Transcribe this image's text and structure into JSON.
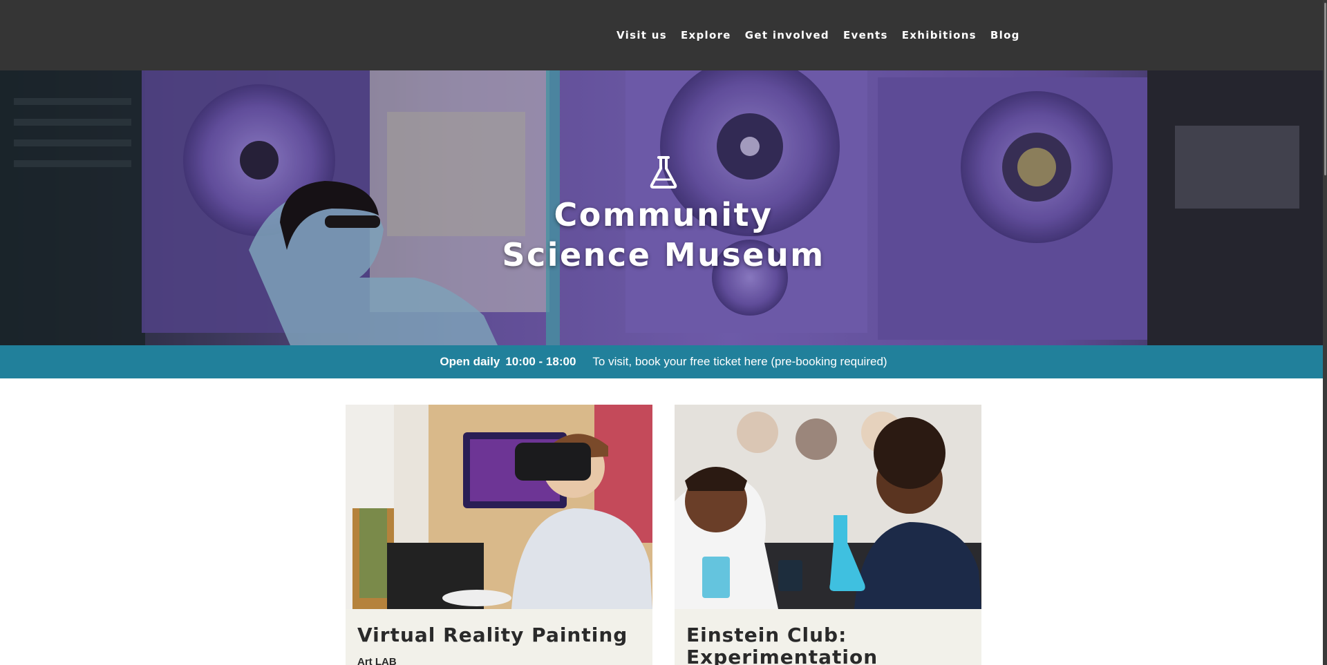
{
  "nav": {
    "items": [
      {
        "label": "Visit us",
        "name": "nav-visit-us"
      },
      {
        "label": "Explore",
        "name": "nav-explore"
      },
      {
        "label": "Get involved",
        "name": "nav-get-involved"
      },
      {
        "label": "Events",
        "name": "nav-events"
      },
      {
        "label": "Exhibitions",
        "name": "nav-exhibitions"
      },
      {
        "label": "Blog",
        "name": "nav-blog"
      }
    ]
  },
  "hero": {
    "icon": "flask-icon",
    "title_line1": "Community",
    "title_line2": "Science Museum"
  },
  "info": {
    "hours_label": "Open daily",
    "hours_value": "10:00 - 18:00",
    "booking_text": "To visit, book your free ticket here (pre-booking required)"
  },
  "cards": [
    {
      "title": "Virtual Reality Painting",
      "subtitle": "Art LAB"
    },
    {
      "title": "Einstein Club: Experimentation",
      "subtitle": ""
    }
  ],
  "colors": {
    "topbar": "#353535",
    "info_strip": "#21809b",
    "card_bg": "#f2f1ea",
    "hero_tint": "#7a5bc4"
  }
}
